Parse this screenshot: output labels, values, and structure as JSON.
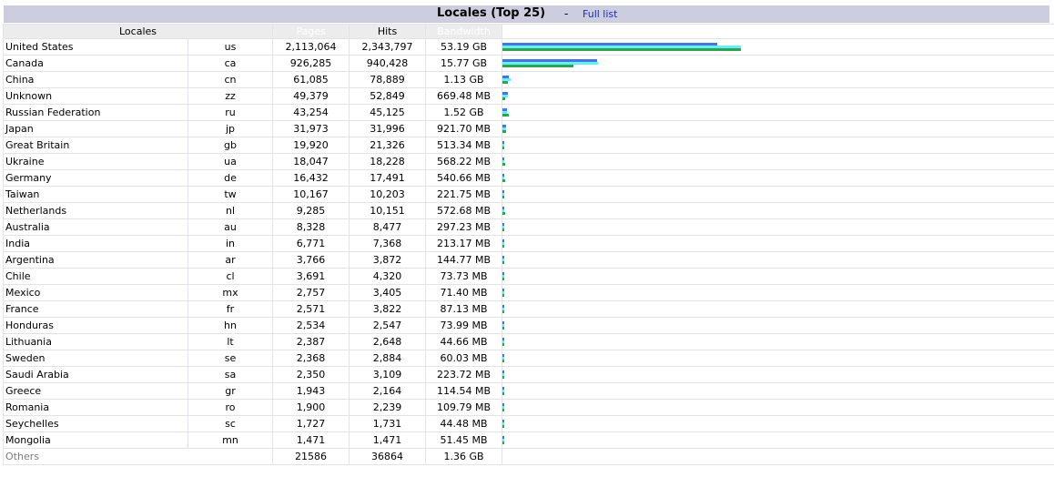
{
  "header": {
    "title": "Locales (Top 25)",
    "separator": "-",
    "full_list_link": "Full list"
  },
  "columns": {
    "locales": "Locales",
    "pages": "Pages",
    "hits": "Hits",
    "bandwidth": "Bandwidth"
  },
  "colors": {
    "pages": "#4477dd",
    "hits": "#66eeff",
    "bandwidth": "#2ea44f"
  },
  "rows": [
    {
      "name": "United States",
      "code": "us",
      "pages": "2,113,064",
      "hits": "2,343,797",
      "bandwidth": "53.19 GB",
      "bars": {
        "pages": 2113064,
        "hits": 2343797,
        "bandwidth_gb": 53.19
      }
    },
    {
      "name": "Canada",
      "code": "ca",
      "pages": "926,285",
      "hits": "940,428",
      "bandwidth": "15.77 GB",
      "bars": {
        "pages": 926285,
        "hits": 940428,
        "bandwidth_gb": 15.77
      }
    },
    {
      "name": "China",
      "code": "cn",
      "pages": "61,085",
      "hits": "78,889",
      "bandwidth": "1.13 GB",
      "bars": {
        "pages": 61085,
        "hits": 78889,
        "bandwidth_gb": 1.13
      }
    },
    {
      "name": "Unknown",
      "code": "zz",
      "pages": "49,379",
      "hits": "52,849",
      "bandwidth": "669.48 MB",
      "bars": {
        "pages": 49379,
        "hits": 52849,
        "bandwidth_gb": 0.654
      }
    },
    {
      "name": "Russian Federation",
      "code": "ru",
      "pages": "43,254",
      "hits": "45,125",
      "bandwidth": "1.52 GB",
      "bars": {
        "pages": 43254,
        "hits": 45125,
        "bandwidth_gb": 1.52
      }
    },
    {
      "name": "Japan",
      "code": "jp",
      "pages": "31,973",
      "hits": "31,996",
      "bandwidth": "921.70 MB",
      "bars": {
        "pages": 31973,
        "hits": 31996,
        "bandwidth_gb": 0.9
      }
    },
    {
      "name": "Great Britain",
      "code": "gb",
      "pages": "19,920",
      "hits": "21,326",
      "bandwidth": "513.34 MB",
      "bars": {
        "pages": 19920,
        "hits": 21326,
        "bandwidth_gb": 0.501
      }
    },
    {
      "name": "Ukraine",
      "code": "ua",
      "pages": "18,047",
      "hits": "18,228",
      "bandwidth": "568.22 MB",
      "bars": {
        "pages": 18047,
        "hits": 18228,
        "bandwidth_gb": 0.555
      }
    },
    {
      "name": "Germany",
      "code": "de",
      "pages": "16,432",
      "hits": "17,491",
      "bandwidth": "540.66 MB",
      "bars": {
        "pages": 16432,
        "hits": 17491,
        "bandwidth_gb": 0.528
      }
    },
    {
      "name": "Taiwan",
      "code": "tw",
      "pages": "10,167",
      "hits": "10,203",
      "bandwidth": "221.75 MB",
      "bars": {
        "pages": 10167,
        "hits": 10203,
        "bandwidth_gb": 0.217
      }
    },
    {
      "name": "Netherlands",
      "code": "nl",
      "pages": "9,285",
      "hits": "10,151",
      "bandwidth": "572.68 MB",
      "bars": {
        "pages": 9285,
        "hits": 10151,
        "bandwidth_gb": 0.559
      }
    },
    {
      "name": "Australia",
      "code": "au",
      "pages": "8,328",
      "hits": "8,477",
      "bandwidth": "297.23 MB",
      "bars": {
        "pages": 8328,
        "hits": 8477,
        "bandwidth_gb": 0.29
      }
    },
    {
      "name": "India",
      "code": "in",
      "pages": "6,771",
      "hits": "7,368",
      "bandwidth": "213.17 MB",
      "bars": {
        "pages": 6771,
        "hits": 7368,
        "bandwidth_gb": 0.208
      }
    },
    {
      "name": "Argentina",
      "code": "ar",
      "pages": "3,766",
      "hits": "3,872",
      "bandwidth": "144.77 MB",
      "bars": {
        "pages": 3766,
        "hits": 3872,
        "bandwidth_gb": 0.141
      }
    },
    {
      "name": "Chile",
      "code": "cl",
      "pages": "3,691",
      "hits": "4,320",
      "bandwidth": "73.73 MB",
      "bars": {
        "pages": 3691,
        "hits": 4320,
        "bandwidth_gb": 0.072
      }
    },
    {
      "name": "Mexico",
      "code": "mx",
      "pages": "2,757",
      "hits": "3,405",
      "bandwidth": "71.40 MB",
      "bars": {
        "pages": 2757,
        "hits": 3405,
        "bandwidth_gb": 0.07
      }
    },
    {
      "name": "France",
      "code": "fr",
      "pages": "2,571",
      "hits": "3,822",
      "bandwidth": "87.13 MB",
      "bars": {
        "pages": 2571,
        "hits": 3822,
        "bandwidth_gb": 0.085
      }
    },
    {
      "name": "Honduras",
      "code": "hn",
      "pages": "2,534",
      "hits": "2,547",
      "bandwidth": "73.99 MB",
      "bars": {
        "pages": 2534,
        "hits": 2547,
        "bandwidth_gb": 0.072
      }
    },
    {
      "name": "Lithuania",
      "code": "lt",
      "pages": "2,387",
      "hits": "2,648",
      "bandwidth": "44.66 MB",
      "bars": {
        "pages": 2387,
        "hits": 2648,
        "bandwidth_gb": 0.044
      }
    },
    {
      "name": "Sweden",
      "code": "se",
      "pages": "2,368",
      "hits": "2,884",
      "bandwidth": "60.03 MB",
      "bars": {
        "pages": 2368,
        "hits": 2884,
        "bandwidth_gb": 0.059
      }
    },
    {
      "name": "Saudi Arabia",
      "code": "sa",
      "pages": "2,350",
      "hits": "3,109",
      "bandwidth": "223.72 MB",
      "bars": {
        "pages": 2350,
        "hits": 3109,
        "bandwidth_gb": 0.218
      }
    },
    {
      "name": "Greece",
      "code": "gr",
      "pages": "1,943",
      "hits": "2,164",
      "bandwidth": "114.54 MB",
      "bars": {
        "pages": 1943,
        "hits": 2164,
        "bandwidth_gb": 0.112
      }
    },
    {
      "name": "Romania",
      "code": "ro",
      "pages": "1,900",
      "hits": "2,239",
      "bandwidth": "109.79 MB",
      "bars": {
        "pages": 1900,
        "hits": 2239,
        "bandwidth_gb": 0.107
      }
    },
    {
      "name": "Seychelles",
      "code": "sc",
      "pages": "1,727",
      "hits": "1,731",
      "bandwidth": "44.48 MB",
      "bars": {
        "pages": 1727,
        "hits": 1731,
        "bandwidth_gb": 0.043
      }
    },
    {
      "name": "Mongolia",
      "code": "mn",
      "pages": "1,471",
      "hits": "1,471",
      "bandwidth": "51.45 MB",
      "bars": {
        "pages": 1471,
        "hits": 1471,
        "bandwidth_gb": 0.05
      }
    }
  ],
  "others": {
    "name": "Others",
    "pages": "21586",
    "hits": "36864",
    "bandwidth": "1.36 GB"
  }
}
